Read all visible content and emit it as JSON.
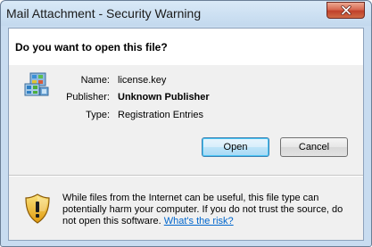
{
  "window": {
    "title": "Mail Attachment - Security Warning"
  },
  "header": {
    "question": "Do you want to open this file?"
  },
  "file": {
    "icon": "registry-file-icon",
    "name_label": "Name:",
    "name_value": "license.key",
    "publisher_label": "Publisher:",
    "publisher_value": "Unknown Publisher",
    "type_label": "Type:",
    "type_value": "Registration Entries"
  },
  "buttons": {
    "open": "Open",
    "cancel": "Cancel"
  },
  "warning": {
    "icon": "shield-warning-icon",
    "text": "While files from the Internet can be useful, this file type can potentially harm your computer. If you do not trust the source, do not open this software.",
    "link": "What's the risk?"
  },
  "colors": {
    "title_bar": "#c3d9ee",
    "close_button": "#c0412b",
    "dialog_body": "#f0f0f0",
    "link": "#0066cc",
    "shield": "#e8b316"
  }
}
